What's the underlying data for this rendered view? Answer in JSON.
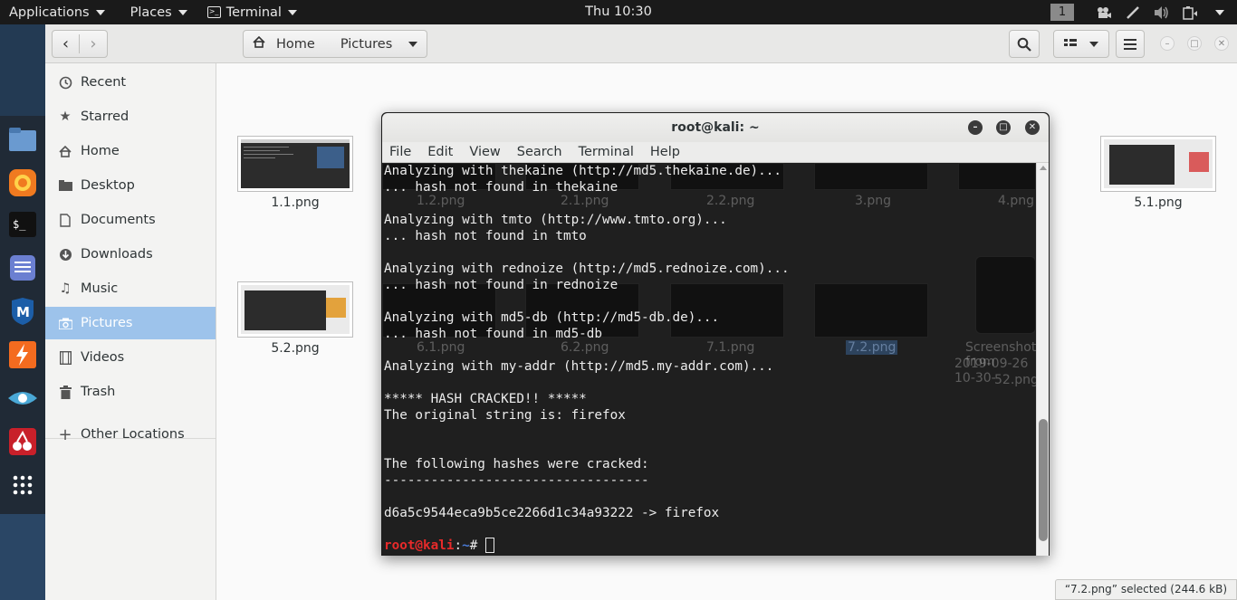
{
  "topbar": {
    "applications": "Applications",
    "places": "Places",
    "terminal": "Terminal",
    "clock": "Thu 10:30",
    "workspace": "1"
  },
  "dock": {
    "items": [
      "files-icon",
      "firefox-icon",
      "terminal-icon",
      "notes-icon",
      "metasploit-icon",
      "burpsuite-icon",
      "eye-icon",
      "cherrytree-icon",
      "app-grid-icon"
    ]
  },
  "nautilus": {
    "path": {
      "home": "Home",
      "current": "Pictures"
    },
    "sidebar": [
      {
        "label": "Recent",
        "icon": "clock-icon"
      },
      {
        "label": "Starred",
        "icon": "star-icon"
      },
      {
        "label": "Home",
        "icon": "home-icon"
      },
      {
        "label": "Desktop",
        "icon": "folder-icon"
      },
      {
        "label": "Documents",
        "icon": "document-icon"
      },
      {
        "label": "Downloads",
        "icon": "download-icon"
      },
      {
        "label": "Music",
        "icon": "music-icon"
      },
      {
        "label": "Pictures",
        "icon": "camera-icon"
      },
      {
        "label": "Videos",
        "icon": "film-icon"
      },
      {
        "label": "Trash",
        "icon": "trash-icon"
      },
      {
        "label": "Other Locations",
        "icon": "plus-icon"
      }
    ],
    "files": [
      {
        "name": "1.1.png"
      },
      {
        "name": "1.2.png"
      },
      {
        "name": "2.1.png"
      },
      {
        "name": "2.2.png"
      },
      {
        "name": "3.png"
      },
      {
        "name": "4.png"
      },
      {
        "name": "5.1.png"
      },
      {
        "name": "5.2.png"
      },
      {
        "name": "6.1.png"
      },
      {
        "name": "6.2.png"
      },
      {
        "name": "7.1.png"
      },
      {
        "name": "7.2.png"
      },
      {
        "name_line1": "Screenshot from",
        "name_line2": "2019-09-26 10-30-",
        "name_line3": "52.png"
      }
    ],
    "status": "“7.2.png” selected  (244.6 kB)"
  },
  "terminal": {
    "title": "root@kali: ~",
    "menu": [
      "File",
      "Edit",
      "View",
      "Search",
      "Terminal",
      "Help"
    ],
    "lines": [
      "Analyzing with thekaine (http://md5.thekaine.de)...",
      "... hash not found in thekaine",
      "",
      "Analyzing with tmto (http://www.tmto.org)...",
      "... hash not found in tmto",
      "",
      "Analyzing with rednoize (http://md5.rednoize.com)...",
      "... hash not found in rednoize",
      "",
      "Analyzing with md5-db (http://md5-db.de)...",
      "... hash not found in md5-db",
      "",
      "Analyzing with my-addr (http://md5.my-addr.com)...",
      "",
      "***** HASH CRACKED!! *****",
      "The original string is: firefox",
      "",
      "",
      "The following hashes were cracked:",
      "----------------------------------",
      "",
      "d6a5c9544eca9b5ce2266d1c34a93222 -> firefox",
      ""
    ],
    "prompt_user": "root@kali",
    "prompt_sep": ":",
    "prompt_path": "~",
    "prompt_symbol": "# "
  }
}
